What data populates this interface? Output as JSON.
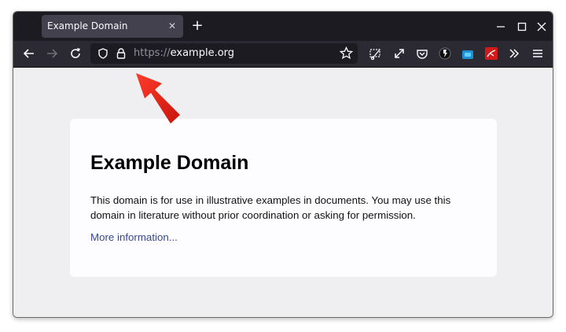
{
  "tab": {
    "title": "Example Domain"
  },
  "urlbar": {
    "scheme": "https://",
    "host": "example.org"
  },
  "extensions": {
    "badge_count": "0"
  },
  "page": {
    "heading": "Example Domain",
    "body": "This domain is for use in illustrative examples in documents. You may use this domain in literature without prior coordination or asking for permission.",
    "link": "More information..."
  },
  "colors": {
    "tabbar_bg": "#1c1b22",
    "toolbar_bg": "#2b2a33",
    "content_bg": "#efeff2",
    "link": "#38488f",
    "annotation_arrow": "#e8261b"
  },
  "icons": [
    "back-arrow-icon",
    "forward-arrow-icon",
    "reload-icon",
    "shield-icon",
    "lock-icon",
    "bookmark-star-icon",
    "screenshot-icon",
    "fullscreen-icon",
    "pocket-icon",
    "extension-icon",
    "container-icon",
    "pdf-extension-icon",
    "overflow-icon",
    "menu-icon"
  ]
}
